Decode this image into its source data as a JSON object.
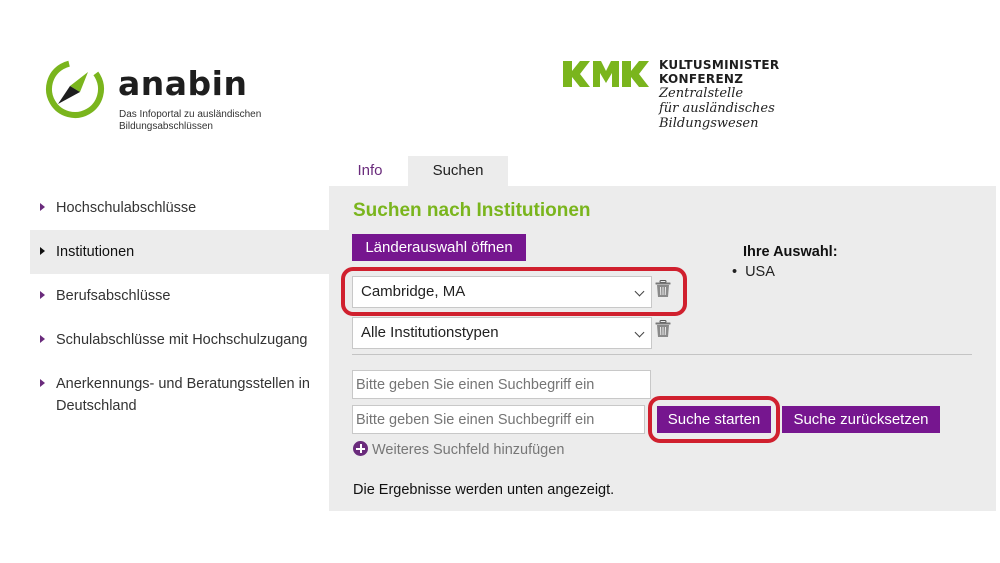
{
  "header": {
    "anabin": {
      "title": "anabin",
      "subtitle": "Das Infoportal zu ausländischen Bildungsabschlüssen",
      "logo_icon": "compass-icon"
    },
    "kmk": {
      "line1": "KULTUSMINISTER",
      "line2": "KONFERENZ",
      "line3": "Zentralstelle",
      "line4": "für ausländisches",
      "line5": "Bildungswesen",
      "logo_icon": "kmk-logo-icon",
      "brand_color": "#7ab51d"
    }
  },
  "tabs": [
    {
      "label": "Info",
      "active": false
    },
    {
      "label": "Suchen",
      "active": true
    }
  ],
  "sidebar": {
    "items": [
      {
        "label": "Hochschulabschlüsse",
        "active": false
      },
      {
        "label": "Institutionen",
        "active": true
      },
      {
        "label": "Berufsabschlüsse",
        "active": false
      },
      {
        "label": "Schulabschlüsse mit Hochschulzugang",
        "active": false
      },
      {
        "label": "Anerkennungs- und Beratungsstellen in Deutschland",
        "active": false
      }
    ]
  },
  "main": {
    "title": "Suchen nach Institutionen",
    "country_button": "Länderauswahl öffnen",
    "city_select": {
      "value": "Cambridge, MA"
    },
    "type_select": {
      "value": "Alle Institutionstypen"
    },
    "selection": {
      "label": "Ihre Auswahl:",
      "items": [
        "USA"
      ]
    },
    "search_fields": [
      {
        "placeholder": "Bitte geben Sie einen Suchbegriff ein"
      },
      {
        "placeholder": "Bitte geben Sie einen Suchbegriff ein"
      }
    ],
    "start_button": "Suche starten",
    "reset_button": "Suche zurücksetzen",
    "add_field": "Weiteres Suchfeld hinzufügen",
    "results_note": "Die Ergebnisse werden unten angezeigt."
  },
  "colors": {
    "accent_purple": "#76168f",
    "title_green": "#7ab51d",
    "highlight_red": "#d0202e"
  }
}
